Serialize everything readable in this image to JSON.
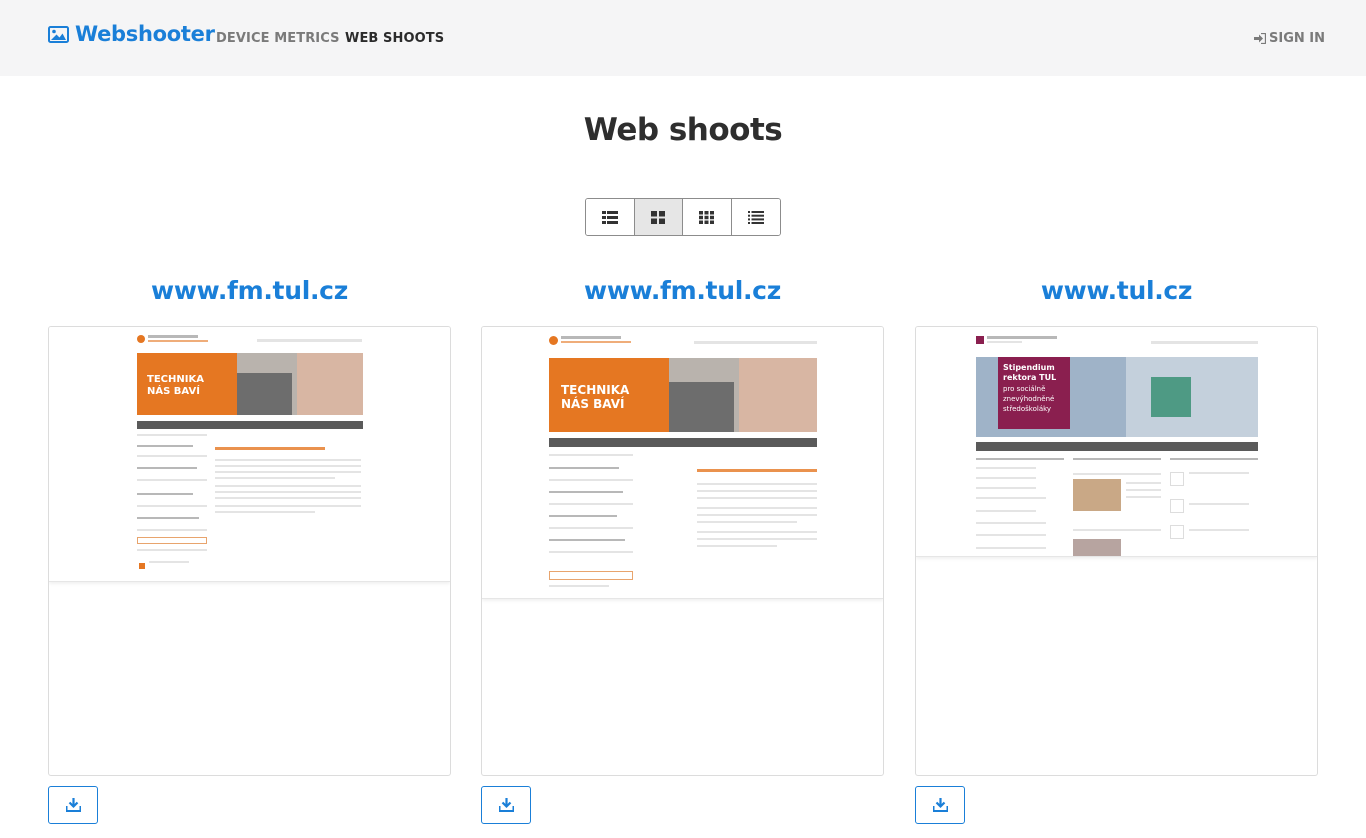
{
  "navbar": {
    "brand": "Webshooter",
    "links": [
      {
        "label": "DEVICE METRICS",
        "active": false
      },
      {
        "label": "WEB SHOOTS",
        "active": true
      }
    ],
    "signin": "SIGN IN"
  },
  "page": {
    "title": "Web shoots"
  },
  "view_toggle": {
    "options": [
      "list-icon",
      "grid-2-icon",
      "grid-3-icon",
      "list-compact-icon"
    ],
    "active_index": 1
  },
  "shoots": [
    {
      "title": "www.fm.tul.cz",
      "hero_text": "TECHNIKA\nNÁS BAVÍ",
      "hero_line1": "TECHNIKA",
      "hero_line2": "NÁS BAVÍ",
      "download_icon": "download-icon"
    },
    {
      "title": "www.fm.tul.cz",
      "hero_line1": "TECHNIKA",
      "hero_line2": "NÁS BAVÍ",
      "download_icon": "download-icon"
    },
    {
      "title": "www.tul.cz",
      "hero_line1": "Stipendium",
      "hero_line2": "rektora TUL",
      "hero_line3": "pro sociálně",
      "hero_line4": "znevýhodněné",
      "hero_line5": "středoškoláky",
      "download_icon": "download-icon"
    }
  ],
  "colors": {
    "brand": "#1a7fd8",
    "navbar_bg": "#f5f5f6",
    "title": "#2e2e2e",
    "hero_orange": "#e57722",
    "hero_purple": "#8a1f4f"
  }
}
